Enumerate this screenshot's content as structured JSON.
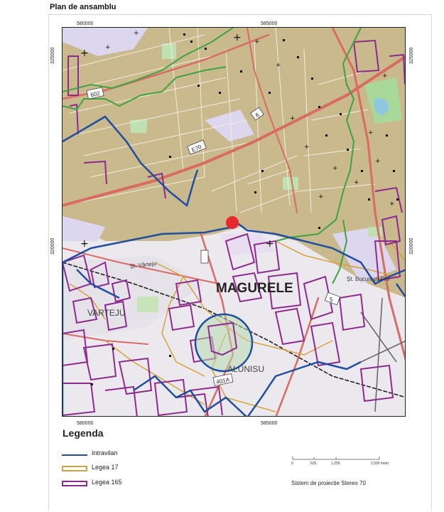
{
  "map": {
    "title": "Plan de ansamblu",
    "coords": {
      "top_left": "580000",
      "top_right": "585000",
      "bottom_left": "580000",
      "bottom_right": "585000",
      "left_top": "325000",
      "left_bottom": "320000",
      "right_top": "325000",
      "right_bottom": "320000"
    },
    "labels": {
      "town": "MAGURELE",
      "village_left": "VARTEJU",
      "village_bottom": "ALUNISU",
      "street_varteju": "Șt. Vârteju",
      "street_bucuresti": "Șt. București Pro",
      "road_e70": "E70",
      "road_602": "602",
      "road_401a": "401A",
      "road_6": "6",
      "road_5": "5"
    },
    "colors": {
      "background_builtup": "#c9b98d",
      "background_open": "#ece9ee",
      "intravilan": "#1f4f9e",
      "legea17": "#d8a23a",
      "legea165": "#8e2a8e",
      "green_boundary": "#3fa33f",
      "road": "#d86b62",
      "site_marker": "#e8282a"
    }
  },
  "legend": {
    "title": "Legenda",
    "items": [
      {
        "label": "Intravilan",
        "color": "#1f4f9e"
      },
      {
        "label": "Legea 17",
        "color": "#d8a23a"
      },
      {
        "label": "Legea 165",
        "color": "#8e2a8e"
      }
    ]
  },
  "scale": {
    "ticks": [
      "0",
      "625",
      "1,250",
      "2,500 metri"
    ]
  },
  "projection": "Sistem de proiectie Stereo 70"
}
